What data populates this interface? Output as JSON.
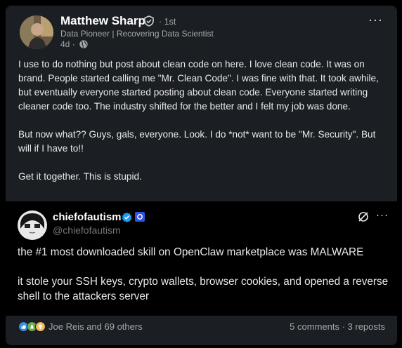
{
  "post": {
    "author": {
      "name": "Matthew Sharp",
      "degree": "· 1st",
      "headline": "Data Pioneer | Recovering Data Scientist",
      "time": "4d ·",
      "verified_icon": "shield-check-icon",
      "visibility_icon": "globe-icon"
    },
    "menu_label": "···",
    "paragraphs": [
      "I use to do nothing but post about clean code on here. I love clean code. It was on brand. People started calling me \"Mr. Clean Code\". I was fine with that. It took awhile, but eventually everyone started posting about clean code. Everyone started writing cleaner code too. The industry shifted for the better and I felt my job was done.",
      "But now what?? Guys, gals, everyone. Look. I do *not* want to be \"Mr. Security\". But will if I have to!!",
      "Get it together. This is stupid."
    ]
  },
  "tweet": {
    "name": "chiefofautism",
    "handle": "@chiefofautism",
    "menu_label": "···",
    "paragraphs": [
      "the #1 most downloaded skill on OpenClaw marketplace was MALWARE",
      "it stole your SSH keys, crypto wallets, browser cookies, and opened a reverse shell to the attackers server"
    ]
  },
  "social": {
    "reactors": "Joe Reis and 69 others",
    "counts": "5 comments · 3 reposts"
  },
  "colors": {
    "card_bg": "#1b1f23",
    "text_primary": "#e9e9e9",
    "text_secondary": "#a6a7a8",
    "verified_blue": "#1d9bf0",
    "like_blue": "#378fe9",
    "celebrate_green": "#44712e",
    "insight_yellow": "#f5bb5c"
  }
}
